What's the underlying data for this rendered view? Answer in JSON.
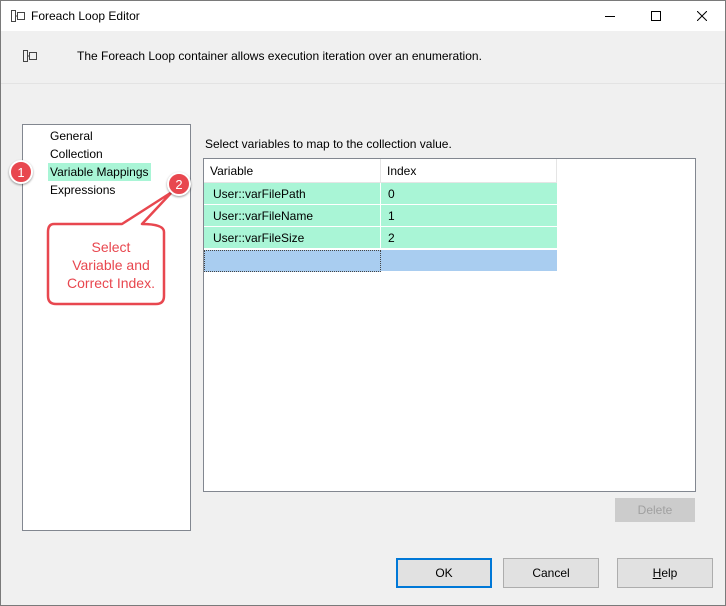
{
  "window": {
    "title": "Foreach Loop Editor",
    "description": "The Foreach Loop container allows execution iteration over an enumeration."
  },
  "nav": {
    "items": [
      {
        "label": "General"
      },
      {
        "label": "Collection"
      },
      {
        "label": "Variable Mappings",
        "selected": true
      },
      {
        "label": "Expressions"
      }
    ]
  },
  "panel": {
    "instruction": "Select variables to map to the collection value.",
    "columns": [
      "Variable",
      "Index"
    ],
    "rows": [
      {
        "variable": "User::varFilePath",
        "index": "0"
      },
      {
        "variable": "User::varFileName",
        "index": "1"
      },
      {
        "variable": "User::varFileSize",
        "index": "2"
      }
    ],
    "delete_label": "Delete"
  },
  "buttons": {
    "ok": "OK",
    "cancel": "Cancel",
    "help_prefix": "H",
    "help_rest": "elp"
  },
  "annotations": {
    "badge1": "1",
    "badge2": "2",
    "callout_line1": "Select",
    "callout_line2": "Variable and",
    "callout_line3": "Correct Index.",
    "color": "#e8474f"
  },
  "colors": {
    "selected_row": "#a9f5d6",
    "new_row": "#a9cdf0",
    "default_button_border": "#0078d7"
  },
  "icons": {
    "app": "foreach-loop-icon",
    "minimize": "minimize-icon",
    "maximize": "maximize-icon",
    "close": "close-icon"
  }
}
